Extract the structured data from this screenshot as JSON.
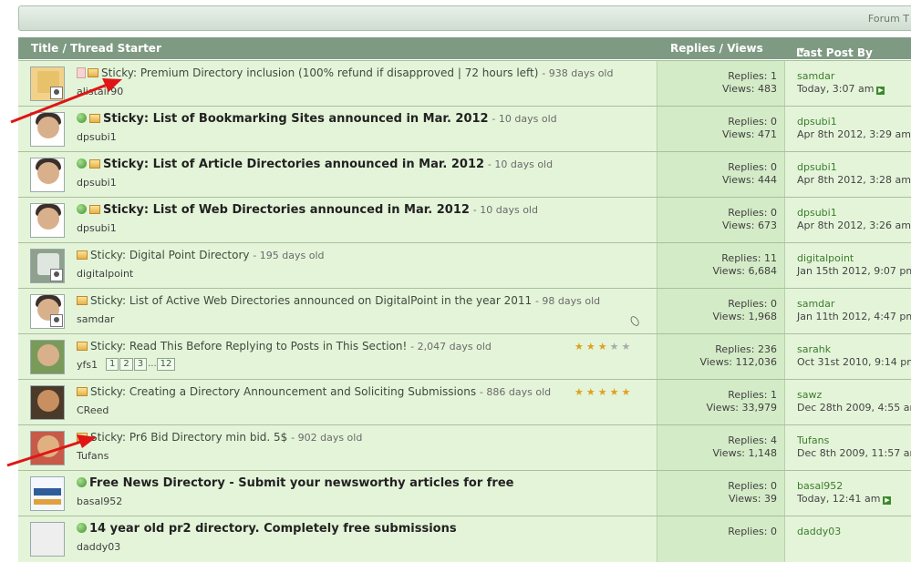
{
  "forum_bar": {
    "text": "Forum T"
  },
  "header": {
    "title_col": "Title / Thread Starter",
    "replies_col": "Replies / Views",
    "last_col": "Last Post By"
  },
  "threads": [
    {
      "title": "Sticky: Premium Directory inclusion (100% refund if disapproved | 72 hours left)",
      "age": "- 938 days old",
      "starter": "alistair90",
      "replies": "Replies: 1",
      "views": "Views: 483",
      "last_user": "samdar",
      "last_date": "Today, 3:07 am"
    },
    {
      "title": "Sticky: List of Bookmarking Sites announced in Mar. 2012",
      "age": "- 10 days old",
      "starter": "dpsubi1",
      "replies": "Replies: 0",
      "views": "Views: 471",
      "last_user": "dpsubi1",
      "last_date": "Apr 8th 2012, 3:29 am"
    },
    {
      "title": "Sticky: List of Article Directories announced in Mar. 2012",
      "age": "- 10 days old",
      "starter": "dpsubi1",
      "replies": "Replies: 0",
      "views": "Views: 444",
      "last_user": "dpsubi1",
      "last_date": "Apr 8th 2012, 3:28 am"
    },
    {
      "title": "Sticky: List of Web Directories announced in Mar. 2012",
      "age": "- 10 days old",
      "starter": "dpsubi1",
      "replies": "Replies: 0",
      "views": "Views: 673",
      "last_user": "dpsubi1",
      "last_date": "Apr 8th 2012, 3:26 am"
    },
    {
      "title": "Sticky: Digital Point Directory",
      "age": "- 195 days old",
      "starter": "digitalpoint",
      "replies": "Replies: 11",
      "views": "Views: 6,684",
      "last_user": "digitalpoint",
      "last_date": "Jan 15th 2012, 9:07 pm"
    },
    {
      "title": "Sticky: List of Active Web Directories announced on DigitalPoint in the year 2011",
      "age": "- 98 days old",
      "starter": "samdar",
      "replies": "Replies: 0",
      "views": "Views: 1,968",
      "last_user": "samdar",
      "last_date": "Jan 11th 2012, 4:47 pm"
    },
    {
      "title": "Sticky: Read This Before Replying to Posts in This Section!",
      "age": "- 2,047 days old",
      "starter": "yfs1",
      "pages": [
        "1",
        "2",
        "3",
        "...",
        "12"
      ],
      "rating": 3,
      "replies": "Replies: 236",
      "views": "Views: 112,036",
      "last_user": "sarahk",
      "last_date": "Oct 31st 2010, 9:14 pm"
    },
    {
      "title": "Sticky: Creating a Directory Announcement and Soliciting Submissions",
      "age": "- 886 days old",
      "starter": "CReed",
      "rating": 5,
      "replies": "Replies: 1",
      "views": "Views: 33,979",
      "last_user": "sawz",
      "last_date": "Dec 28th 2009, 4:55 am"
    },
    {
      "title": "Sticky: Pr6 Bid Directory min bid. 5$",
      "age": "- 902 days old",
      "starter": "Tufans",
      "replies": "Replies: 4",
      "views": "Views: 1,148",
      "last_user": "Tufans",
      "last_date": "Dec 8th 2009, 11:57 am"
    },
    {
      "title": "Free News Directory - Submit your newsworthy articles for free",
      "age": "",
      "starter": "basal952",
      "replies": "Replies: 0",
      "views": "Views: 39",
      "last_user": "basal952",
      "last_date": "Today, 12:41 am"
    },
    {
      "title": "14 year old pr2 directory. Completely free submissions",
      "age": "",
      "starter": "daddy03",
      "replies": "Replies: 0",
      "views": "",
      "last_user": "daddy03",
      "last_date": ""
    }
  ],
  "colors": {
    "header": "#7f9a82",
    "row": "#e4f4d9",
    "row_mid": "#d4ebc7",
    "arrow": "#e01515",
    "link": "#3b7d2c"
  }
}
